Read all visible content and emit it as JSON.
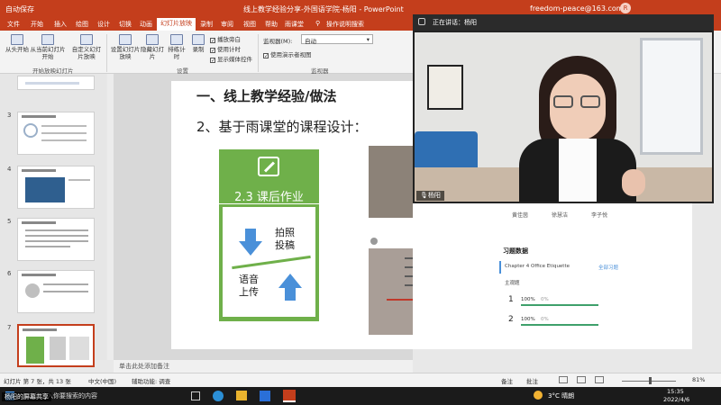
{
  "titlebar": {
    "autosave": "自动保存",
    "doc_title": "线上教学经验分享-外国语学院-杨阳 - PowerPoint",
    "user_email": "freedom-peace@163.com",
    "avatar_letter": "R"
  },
  "tabs": [
    "文件",
    "开始",
    "插入",
    "绘图",
    "设计",
    "切换",
    "动画",
    "幻灯片放映",
    "录制",
    "审阅",
    "视图",
    "帮助",
    "雨课堂",
    "操作说明搜索"
  ],
  "ribbon": {
    "btn_from_start": "从头开始",
    "btn_from_current": "从当前幻灯片开始",
    "btn_custom": "自定义幻灯片放映",
    "group_start": "开始放映幻灯片",
    "btn_setup": "设置幻灯片放映",
    "btn_hide": "隐藏幻灯片",
    "btn_rehearse": "排练计时",
    "btn_record": "录制",
    "chk_narration": "播放旁白",
    "chk_timing": "使用计时",
    "chk_media": "显示媒体控件",
    "group_setup": "设置",
    "monitor_label": "监视器(M):",
    "monitor_value": "自动",
    "chk_presenter": "使用演示者视图",
    "group_monitor": "监视器"
  },
  "thumbnails": [
    {
      "num": "3",
      "active": false
    },
    {
      "num": "4",
      "active": false
    },
    {
      "num": "5",
      "active": false
    },
    {
      "num": "6",
      "active": false
    },
    {
      "num": "7",
      "active": true
    }
  ],
  "slide": {
    "heading": "一、线上教学经验/做法",
    "subheading": "2、基于雨课堂的课程设计：",
    "card_title": "2.3 课后作业",
    "card_label_photo": "拍照\n投稿",
    "card_label_voice": "语音\n上传"
  },
  "phone_panel": {
    "names": [
      "黄佳茵",
      "徐慧洁",
      "李子悦"
    ],
    "title": "习题数据",
    "chapter": "Chapter 4 Office Etiquette",
    "tab_all": "全部习题",
    "row_label": "主观题",
    "q1": "1",
    "q2": "2",
    "pct1": "100%",
    "pct2": "100%",
    "zero": "0%"
  },
  "video": {
    "header": "正在讲话：杨阳",
    "name_tag": "杨阳"
  },
  "notes": {
    "placeholder": "单击此处添加备注"
  },
  "statusbar": {
    "slide_info": "幻灯片 第 7 张，共 13 张",
    "language": "中文(中国)",
    "accessibility": "辅助功能: 调查",
    "notes_btn": "备注",
    "comments_btn": "批注",
    "zoom": "81%"
  },
  "taskbar": {
    "search_placeholder": "在这里输入你要搜索的内容",
    "share_label": "杨阳的屏幕共享",
    "weather": "3°C 晴朗",
    "time": "15:35",
    "date": "2022/4/6"
  },
  "colors": {
    "accent": "#c43e1c",
    "green": "#6fb04a",
    "blue": "#4a90d9"
  }
}
